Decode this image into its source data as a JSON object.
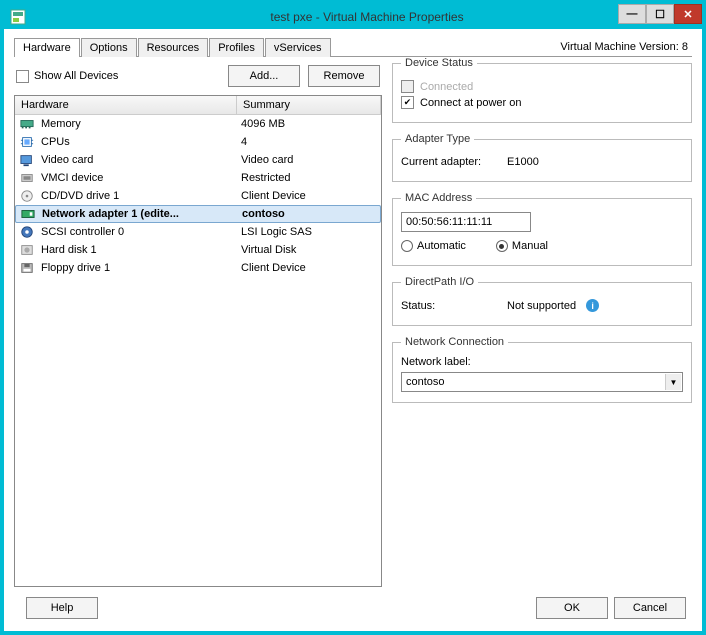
{
  "window": {
    "title": "test pxe - Virtual Machine Properties"
  },
  "tabs": {
    "hardware": "Hardware",
    "options": "Options",
    "resources": "Resources",
    "profiles": "Profiles",
    "vservices": "vServices"
  },
  "version_label": "Virtual Machine Version: 8",
  "top": {
    "show_all": "Show All Devices",
    "add": "Add...",
    "remove": "Remove"
  },
  "hw_header": {
    "hardware": "Hardware",
    "summary": "Summary"
  },
  "hw": [
    {
      "icon": "memory",
      "name": "Memory",
      "summary": "4096 MB"
    },
    {
      "icon": "cpu",
      "name": "CPUs",
      "summary": "4"
    },
    {
      "icon": "video",
      "name": "Video card",
      "summary": "Video card"
    },
    {
      "icon": "vmci",
      "name": "VMCI device",
      "summary": "Restricted"
    },
    {
      "icon": "cd",
      "name": "CD/DVD drive 1",
      "summary": "Client Device"
    },
    {
      "icon": "nic",
      "name": "Network adapter 1 (edite...",
      "summary": "contoso"
    },
    {
      "icon": "scsi",
      "name": "SCSI controller 0",
      "summary": "LSI Logic SAS"
    },
    {
      "icon": "hdd",
      "name": "Hard disk 1",
      "summary": "Virtual Disk"
    },
    {
      "icon": "floppy",
      "name": "Floppy drive 1",
      "summary": "Client Device"
    }
  ],
  "panel": {
    "device_status": {
      "legend": "Device Status",
      "connected": "Connected",
      "connect_power": "Connect at power on"
    },
    "adapter_type": {
      "legend": "Adapter Type",
      "current_label": "Current adapter:",
      "current_value": "E1000"
    },
    "mac": {
      "legend": "MAC Address",
      "value": "00:50:56:11:11:11",
      "automatic": "Automatic",
      "manual": "Manual"
    },
    "directpath": {
      "legend": "DirectPath I/O",
      "status_label": "Status:",
      "status_value": "Not supported"
    },
    "network": {
      "legend": "Network Connection",
      "label": "Network label:",
      "value": "contoso"
    }
  },
  "footer": {
    "help": "Help",
    "ok": "OK",
    "cancel": "Cancel"
  }
}
